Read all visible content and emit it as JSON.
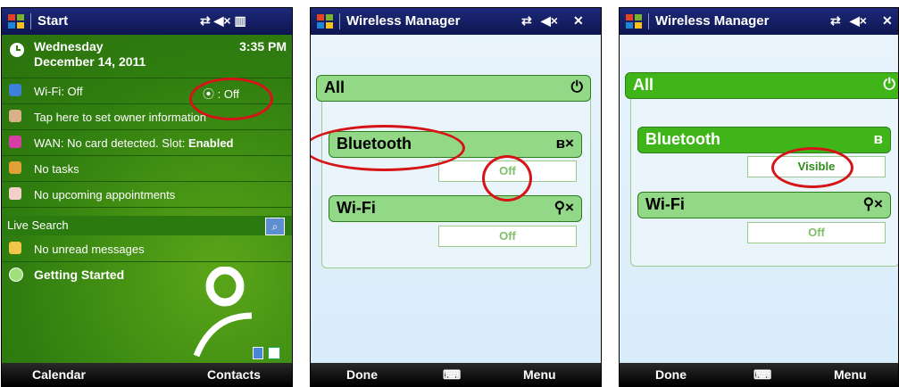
{
  "screen1": {
    "title": "Start",
    "status_icons": "⇄ ◀× ▥",
    "date_day": "Wednesday",
    "date_full": "December 14, 2011",
    "time": "3:35 PM",
    "rows": [
      {
        "text": "Wi-Fi: Off",
        "extra": "⦿ : Off",
        "icon_color": "#3f7fdc"
      },
      {
        "text": "Tap here to set owner information",
        "icon_color": "#d8b08a"
      },
      {
        "text": "WAN: No card detected.  Slot: ",
        "bold": "Enabled",
        "icon_color": "#d43fa3"
      },
      {
        "text": "No tasks",
        "icon_color": "#e3a037"
      },
      {
        "text": "No upcoming appointments",
        "icon_color": "#f4d0c8"
      }
    ],
    "search_label": "Live Search",
    "messages": "No unread messages",
    "getting_started": "Getting Started",
    "soft_left": "Calendar",
    "soft_right": "Contacts"
  },
  "screen2": {
    "title": "Wireless Manager",
    "all_label": "All",
    "bluetooth_label": "Bluetooth",
    "bluetooth_status": "Off",
    "wifi_label": "Wi-Fi",
    "wifi_status": "Off",
    "soft_left": "Done",
    "soft_right": "Menu"
  },
  "screen3": {
    "title": "Wireless Manager",
    "all_label": "All",
    "bluetooth_label": "Bluetooth",
    "bluetooth_status": "Visible",
    "wifi_label": "Wi-Fi",
    "wifi_status": "Off",
    "soft_left": "Done",
    "soft_right": "Menu"
  },
  "colors": {
    "accent_green": "#3fb51a",
    "status_green": "#2f8b1c",
    "highlight_red": "#d61417"
  }
}
